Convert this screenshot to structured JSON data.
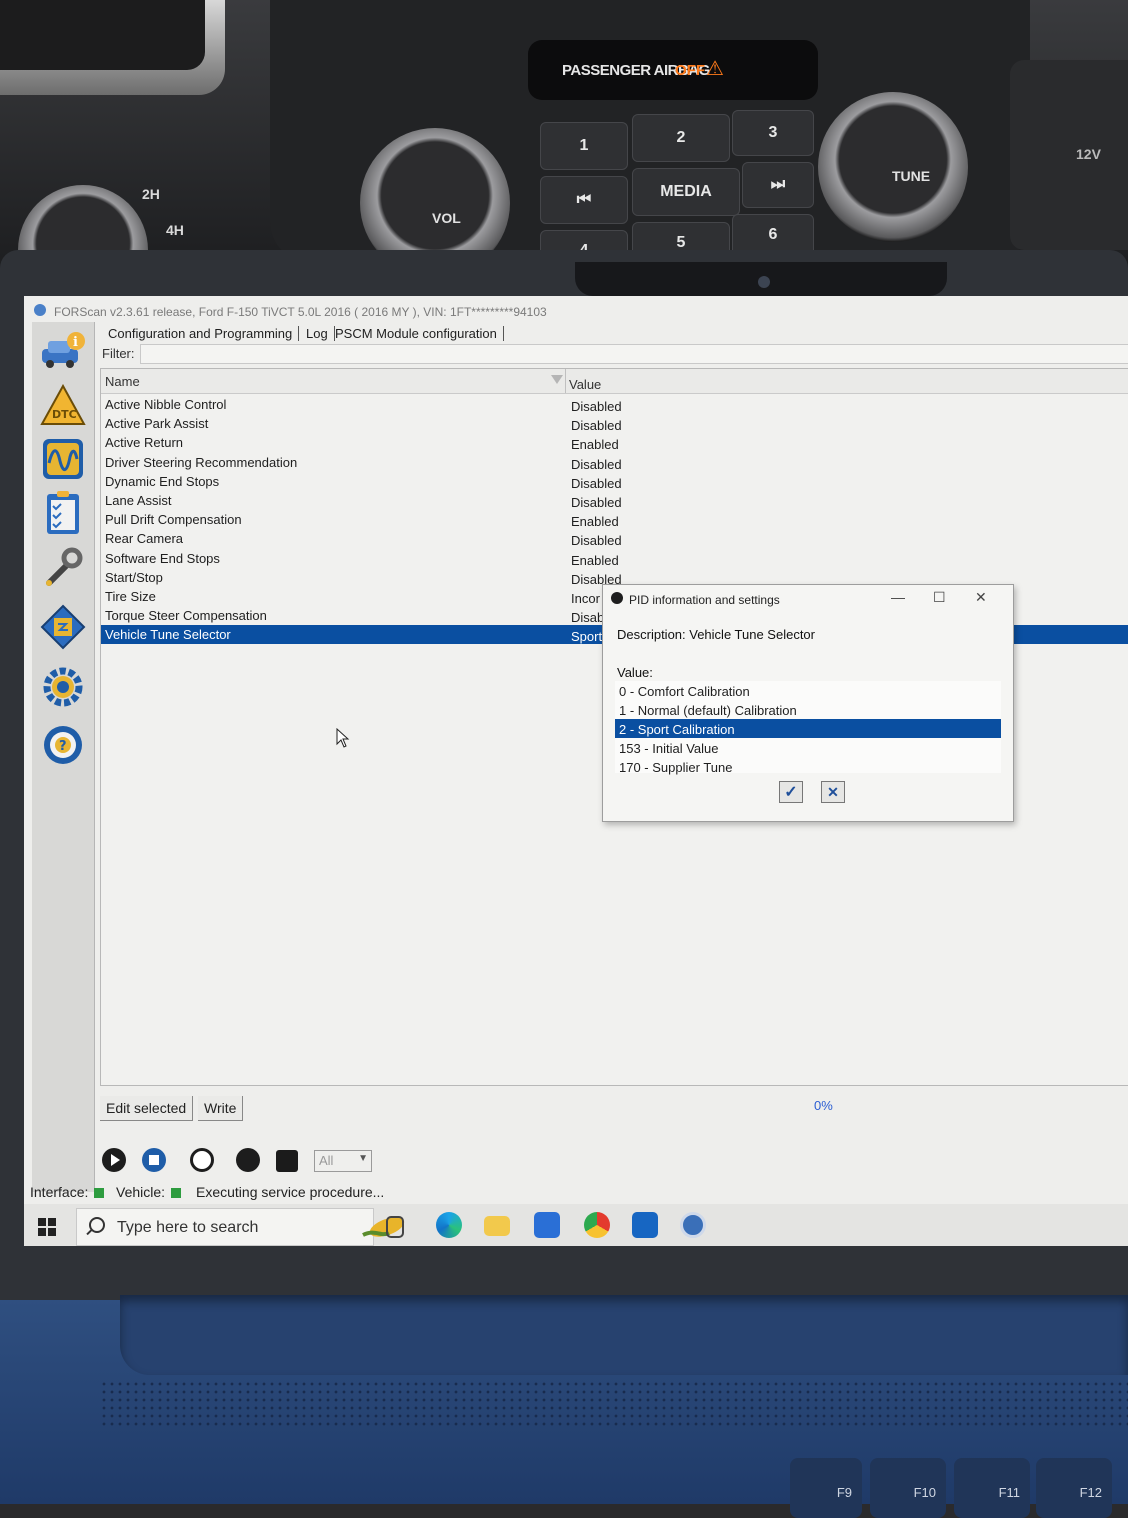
{
  "dashboard": {
    "airbag_label": "PASSENGER AIRBAG",
    "airbag_status": "OFF",
    "drive_modes": [
      "2H",
      "4H"
    ],
    "vol_label": "VOL",
    "tune_label": "TUNE",
    "media_label": "MEDIA",
    "presets": [
      "1",
      "2",
      "3",
      "4",
      "5",
      "6"
    ],
    "power_label": "12V"
  },
  "window": {
    "title": "FORScan v2.3.61 release, Ford F-150 TiVCT 5.0L 2016 ( 2016 MY ), VIN: 1FT*********94103"
  },
  "tabs": [
    "Configuration and Programming",
    "Log",
    "PSCM Module configuration"
  ],
  "filter": {
    "label": "Filter:",
    "value": ""
  },
  "table": {
    "columns": {
      "name": "Name",
      "value": "Value"
    },
    "rows": [
      {
        "name": "Active Nibble Control",
        "value": "Disabled"
      },
      {
        "name": "Active Park Assist",
        "value": "Disabled"
      },
      {
        "name": "Active Return",
        "value": "Enabled"
      },
      {
        "name": "Driver Steering Recommendation",
        "value": "Disabled"
      },
      {
        "name": "Dynamic End Stops",
        "value": "Disabled"
      },
      {
        "name": "Lane Assist",
        "value": "Disabled"
      },
      {
        "name": "Pull Drift Compensation",
        "value": "Enabled"
      },
      {
        "name": "Rear Camera",
        "value": "Disabled"
      },
      {
        "name": "Software End Stops",
        "value": "Enabled"
      },
      {
        "name": "Start/Stop",
        "value": "Disabled"
      },
      {
        "name": "Tire Size",
        "value": "Incor"
      },
      {
        "name": "Torque Steer Compensation",
        "value": "Disab"
      },
      {
        "name": "Vehicle Tune Selector",
        "value": "Sport"
      }
    ],
    "selected_row": 12
  },
  "buttons": {
    "edit_selected": "Edit selected",
    "write": "Write"
  },
  "progress": {
    "text": "0%",
    "value": 0
  },
  "toolbar": {
    "combo_value": "All"
  },
  "status": {
    "interface_label": "Interface:",
    "vehicle_label": "Vehicle:",
    "message": "Executing service procedure..."
  },
  "taskbar": {
    "search_placeholder": "Type here to search"
  },
  "dialog": {
    "title": "PID information and settings",
    "description": "Description: Vehicle Tune Selector",
    "value_label": "Value:",
    "options": [
      "0 - Comfort Calibration",
      "1 - Normal (default) Calibration",
      "2 - Sport Calibration",
      "153 - Initial Value",
      "170 - Supplier Tune"
    ],
    "selected_option": 2,
    "controls": {
      "minimize": "—",
      "maximize": "☐",
      "close": "✕"
    },
    "ok_icon": "✓",
    "cancel_icon": "✕"
  },
  "keyboard": {
    "keys": [
      "F9",
      "F10",
      "F11",
      "F12"
    ]
  },
  "colors": {
    "selection": "#0a4fa1",
    "accent_orange": "#ff7a1a",
    "status_green": "#2d9c3f"
  }
}
